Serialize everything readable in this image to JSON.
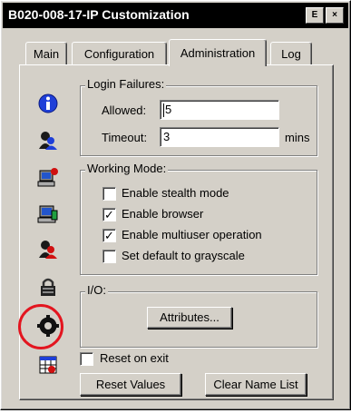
{
  "window": {
    "title": "B020-008-17-IP Customization",
    "help_button": "E",
    "close_button": "×"
  },
  "tabs": [
    {
      "label": "Main",
      "active": false
    },
    {
      "label": "Configuration",
      "active": false
    },
    {
      "label": "Administration",
      "active": true
    },
    {
      "label": "Log",
      "active": false
    }
  ],
  "sidebar_icons": [
    {
      "name": "info-icon"
    },
    {
      "name": "user-icon"
    },
    {
      "name": "computer-alert-icon"
    },
    {
      "name": "computer-icon"
    },
    {
      "name": "user-red-icon"
    },
    {
      "name": "lock-icon"
    },
    {
      "name": "gear-icon",
      "highlighted": true
    },
    {
      "name": "calendar-icon"
    }
  ],
  "login_failures": {
    "legend": "Login Failures:",
    "allowed_label": "Allowed:",
    "allowed_value": "5",
    "timeout_label": "Timeout:",
    "timeout_value": "3",
    "timeout_unit": "mins"
  },
  "working_mode": {
    "legend": "Working Mode:",
    "options": [
      {
        "label": "Enable stealth mode",
        "checked": false
      },
      {
        "label": "Enable browser",
        "checked": true
      },
      {
        "label": "Enable multiuser operation",
        "checked": true
      },
      {
        "label": "Set default to grayscale",
        "checked": false
      }
    ]
  },
  "io": {
    "legend": "I/O:",
    "attributes_button": "Attributes..."
  },
  "reset_on_exit": {
    "label": "Reset on exit",
    "checked": false
  },
  "buttons": {
    "reset_values": "Reset Values",
    "clear_name_list": "Clear Name List"
  },
  "colors": {
    "highlight_ring": "#e3151f",
    "face": "#d4d0c8",
    "titlebar": "#000000"
  }
}
